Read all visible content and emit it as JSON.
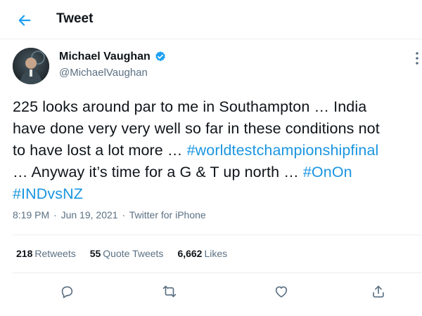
{
  "header": {
    "title": "Tweet",
    "back_icon": "back-arrow-icon"
  },
  "author": {
    "display_name": "Michael Vaughan",
    "handle": "@MichaelVaughan",
    "verified": true,
    "verified_icon": "verified-badge-icon"
  },
  "tweet": {
    "lines": [
      [
        {
          "text": "225 looks around par to me in Southampton … India",
          "hashtag": false
        }
      ],
      [
        {
          "text": "have done very very well so far in these conditions not",
          "hashtag": false
        }
      ],
      [
        {
          "text": "to have lost a lot more … ",
          "hashtag": false
        },
        {
          "text": "#worldtestchampionshipfinal",
          "hashtag": true
        }
      ],
      [
        {
          "text": "… Anyway it’s time for a G & T up north … ",
          "hashtag": false
        },
        {
          "text": "#OnOn",
          "hashtag": true
        }
      ],
      [
        {
          "text": "#INDvsNZ",
          "hashtag": true
        }
      ]
    ],
    "time": "8:19 PM",
    "date": "Jun 19, 2021",
    "separator": "·",
    "source": "Twitter for iPhone"
  },
  "stats": {
    "retweets_count": "218",
    "retweets_label": "Retweets",
    "quotes_count": "55",
    "quotes_label": "Quote Tweets",
    "likes_count": "6,662",
    "likes_label": "Likes"
  },
  "actions": {
    "icons": [
      "reply-icon",
      "retweet-icon",
      "like-icon",
      "share-icon"
    ]
  },
  "colors": {
    "link": "#1b95e0",
    "accent": "#1da1f2",
    "muted": "#5b7083",
    "text": "#0f1419",
    "border": "#ebeef0"
  }
}
